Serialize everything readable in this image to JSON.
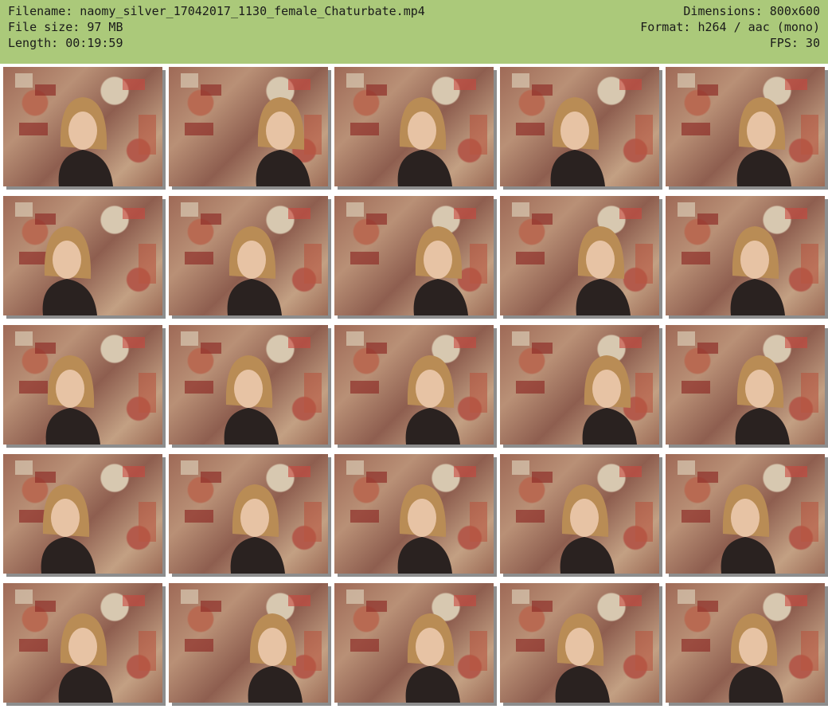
{
  "header": {
    "filename": "Filename: naomy_silver_17042017_1130_female_Chaturbate.mp4",
    "filesize": "File size: 97 MB",
    "length": "Length: 00:19:59",
    "dimensions": "Dimensions: 800x600",
    "format": "Format: h264 / aac (mono)",
    "fps": "FPS: 30"
  },
  "thumbnails": {
    "rows": 5,
    "columns": 5
  }
}
